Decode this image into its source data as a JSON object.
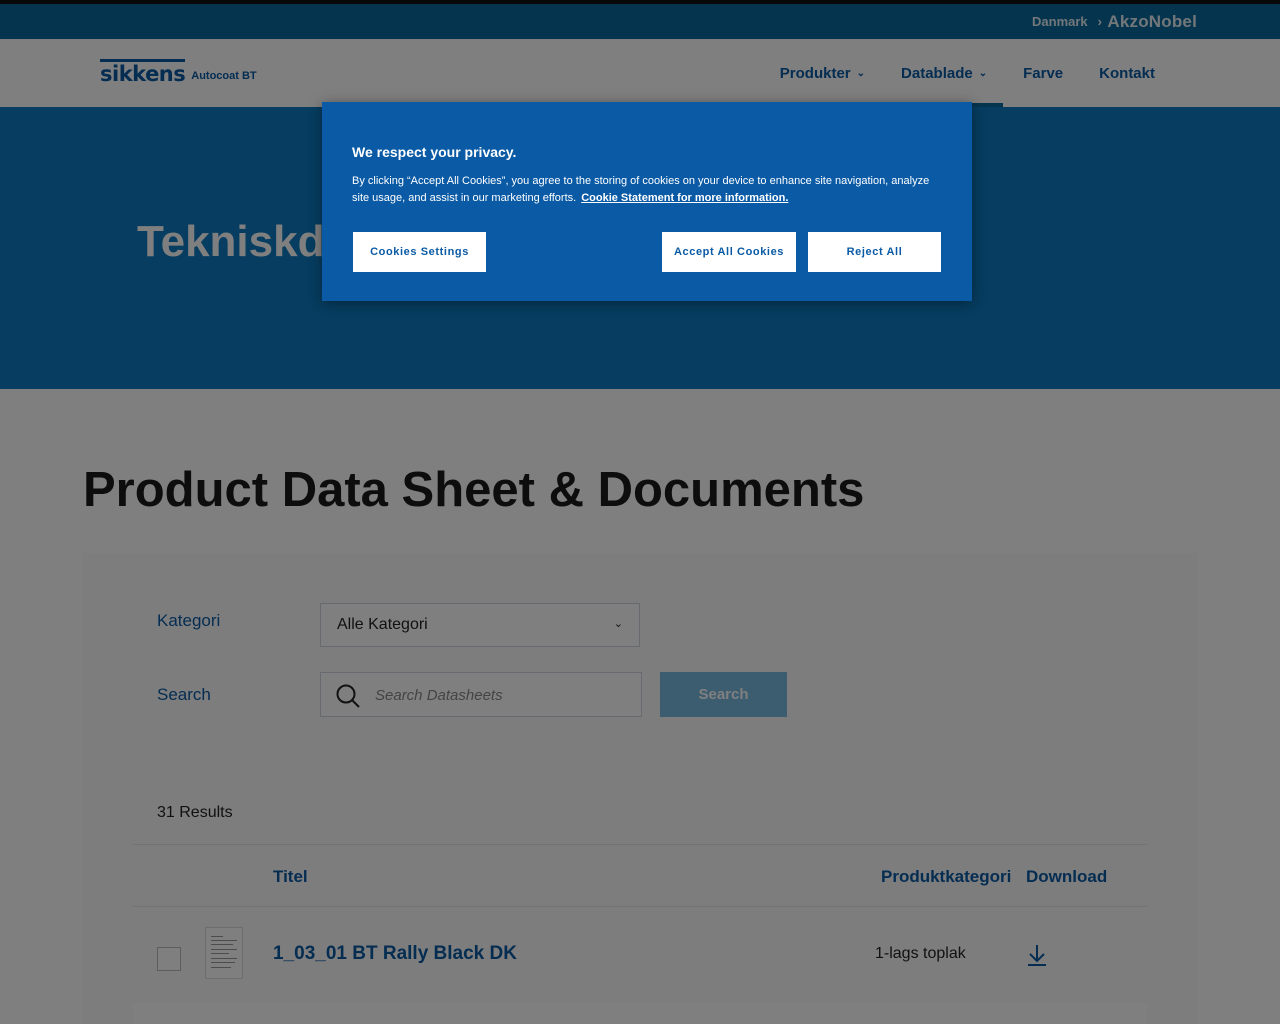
{
  "topbar": {
    "country": "Danmark",
    "brand": "AkzoNobel"
  },
  "header": {
    "logo_brand": "sikkens",
    "logo_sub": "Autocoat BT",
    "nav": [
      {
        "label": "Produkter"
      },
      {
        "label": "Datablade"
      },
      {
        "label": "Farve"
      },
      {
        "label": "Kontakt"
      }
    ]
  },
  "hero": {
    "title": "Tekniskdatablade"
  },
  "main": {
    "title": "Product Data Sheet & Documents",
    "category_label": "Kategori",
    "category_value": "Alle Kategori",
    "search_label": "Search",
    "search_placeholder": "Search Datasheets",
    "search_button": "Search",
    "results": "31 Results",
    "columns": {
      "title": "Titel",
      "category": "Produktkategori",
      "download": "Download"
    },
    "rows": [
      {
        "title": "1_03_01 BT Rally Black DK",
        "category": "1-lags toplak"
      }
    ]
  },
  "consent": {
    "heading": "We respect your privacy.",
    "body": "By clicking “Accept All Cookies”, you agree to the storing of cookies on your device to enhance site navigation, analyze site usage, and assist in our marketing efforts.",
    "link": "Cookie Statement for more information.",
    "settings": "Cookies Settings",
    "accept": "Accept All Cookies",
    "reject": "Reject All"
  }
}
